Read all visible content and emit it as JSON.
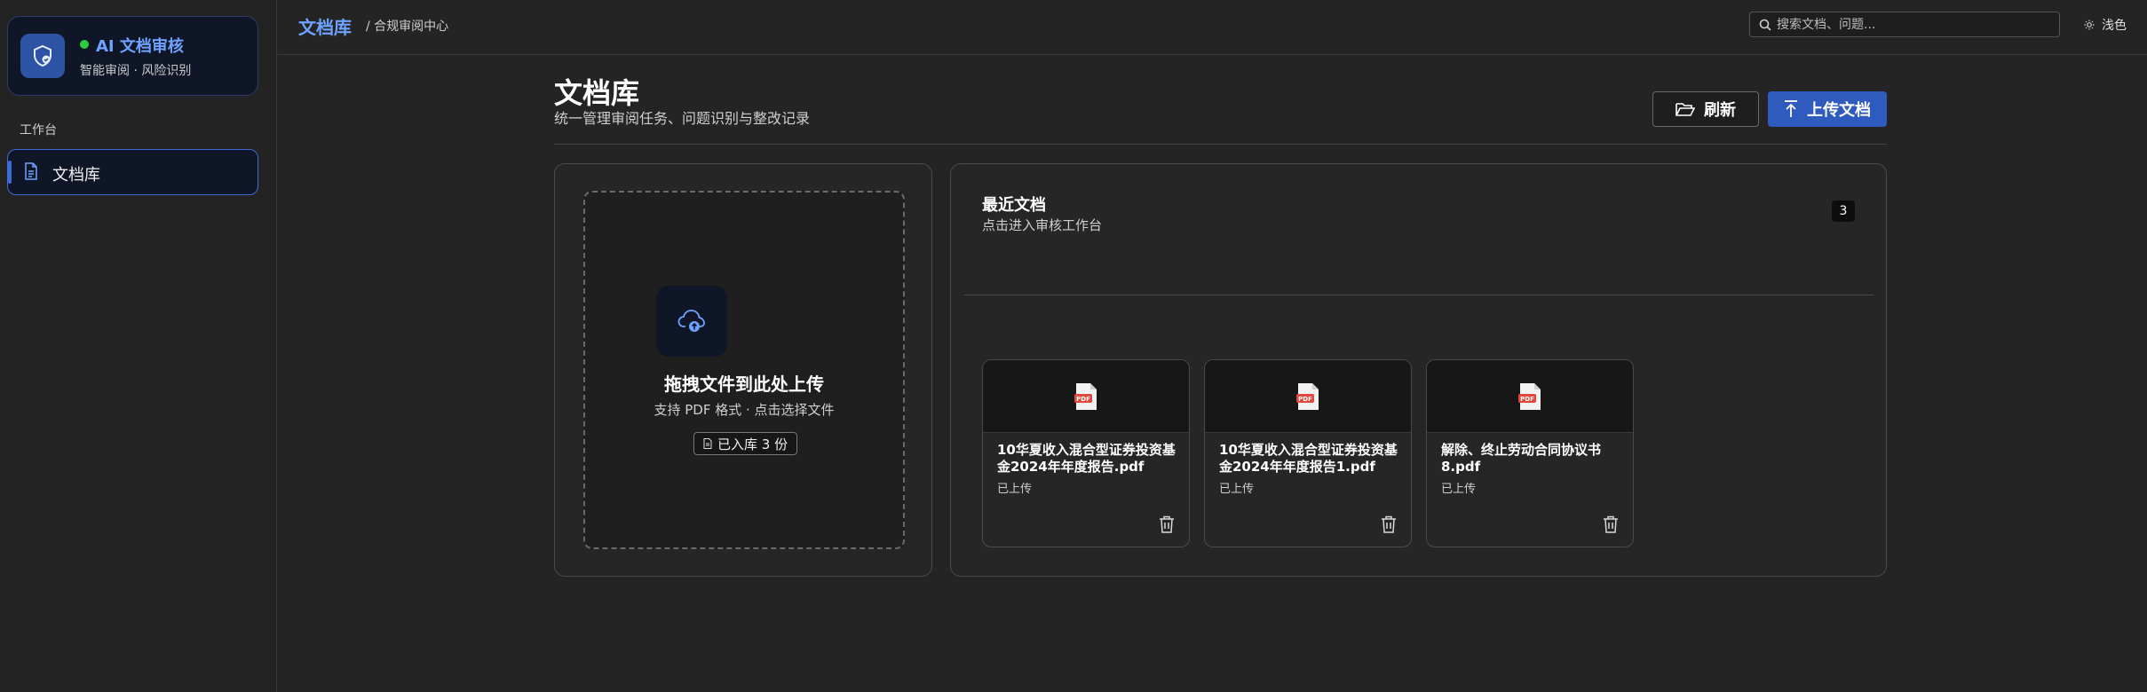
{
  "brand": {
    "title": "AI 文档审核",
    "subtitle": "智能审阅 · 风险识别",
    "status_color": "#2ecc40",
    "logo_icon": "shield-check-icon"
  },
  "sidebar": {
    "section_label": "工作台",
    "items": [
      {
        "label": "文档库",
        "icon": "document-icon",
        "active": true
      }
    ]
  },
  "topbar": {
    "breadcrumb_main": "文档库",
    "breadcrumb_sub": "/ 合规审阅中心",
    "search_placeholder": "搜索文档、问题...",
    "theme_label": "浅色",
    "theme_icon": "sun-icon"
  },
  "page": {
    "title": "文档库",
    "subtitle": "统一管理审阅任务、问题识别与整改记录",
    "refresh_label": "刷新",
    "upload_label": "上传文档"
  },
  "upload": {
    "title": "拖拽文件到此处上传",
    "hint": "支持 PDF 格式 · 点击选择文件",
    "badge": "已入库 3 份"
  },
  "recent": {
    "title": "最近文档",
    "subtitle": "点击进入审核工作台",
    "count": "3",
    "documents": [
      {
        "name": "10华夏收入混合型证券投资基金2024年年度报告.pdf",
        "status": "已上传",
        "icon": "pdf-icon"
      },
      {
        "name": "10华夏收入混合型证券投资基金2024年年度报告1.pdf",
        "status": "已上传",
        "icon": "pdf-icon"
      },
      {
        "name": "解除、终止劳动合同协议书8.pdf",
        "status": "已上传",
        "icon": "pdf-icon"
      }
    ]
  },
  "colors": {
    "accent": "#2f5bbf",
    "link": "#6fa3ff",
    "background": "#242424"
  }
}
